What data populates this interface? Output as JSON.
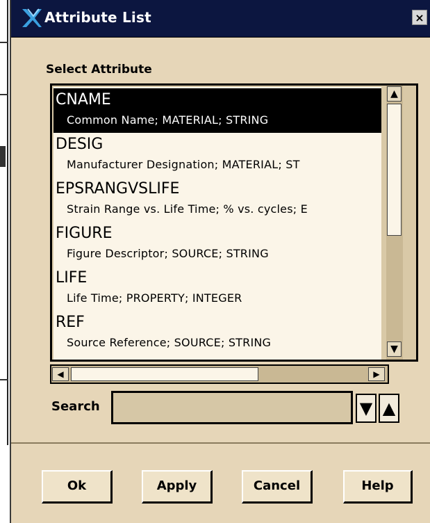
{
  "dialog": {
    "title": "Attribute List",
    "close_label": "×"
  },
  "select_label": "Select Attribute",
  "attributes": [
    {
      "name": "CNAME",
      "description": "Common Name; MATERIAL; STRING",
      "selected": true
    },
    {
      "name": "DESIG",
      "description": "Manufacturer Designation; MATERIAL; ST",
      "selected": false
    },
    {
      "name": "EPSRANGVSLIFE",
      "description": "Strain Range vs. Life Time; % vs. cycles; E",
      "selected": false
    },
    {
      "name": "FIGURE",
      "description": "Figure Descriptor; SOURCE; STRING",
      "selected": false
    },
    {
      "name": "LIFE",
      "description": "Life Time; PROPERTY; INTEGER",
      "selected": false
    },
    {
      "name": "REF",
      "description": "Source Reference; SOURCE; STRING",
      "selected": false
    }
  ],
  "search": {
    "label": "Search",
    "value": "",
    "down_label": "▼",
    "up_label": "▲"
  },
  "buttons": {
    "ok": "Ok",
    "apply": "Apply",
    "cancel": "Cancel",
    "help": "Help"
  },
  "scrollbar": {
    "up_glyph": "▲",
    "down_glyph": "▼",
    "left_glyph": "◀",
    "right_glyph": "▶"
  },
  "colors": {
    "titlebar": "#0c1640",
    "dialog_bg": "#e6d6b8",
    "list_bg": "#fbf5e8",
    "selection": "#000000"
  }
}
